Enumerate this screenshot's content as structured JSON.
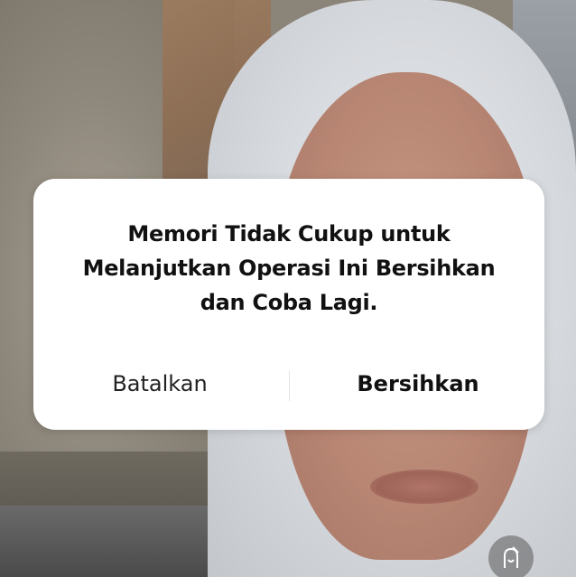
{
  "dialog": {
    "message": "Memori Tidak Cukup untuk\nMelanjutkan Operasi Ini Bersihkan\ndan Coba Lagi.",
    "cancel_label": "Batalkan",
    "confirm_label": "Bersihkan"
  },
  "icons": {
    "corner": "cleanup-icon"
  },
  "colors": {
    "dialog_background": "#ffffff",
    "text_primary": "#111111"
  }
}
